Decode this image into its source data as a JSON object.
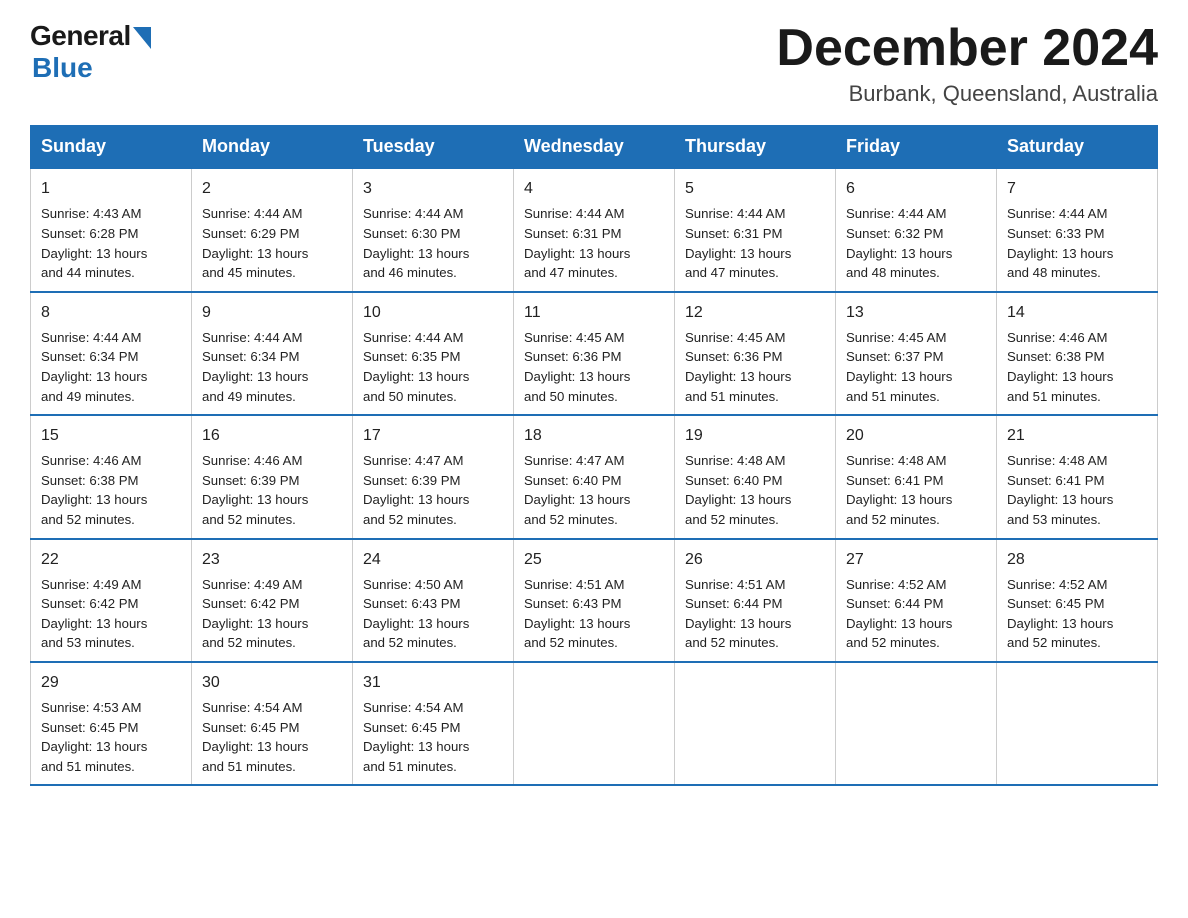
{
  "header": {
    "logo_general": "General",
    "logo_blue": "Blue",
    "month_title": "December 2024",
    "location": "Burbank, Queensland, Australia"
  },
  "days_of_week": [
    "Sunday",
    "Monday",
    "Tuesday",
    "Wednesday",
    "Thursday",
    "Friday",
    "Saturday"
  ],
  "weeks": [
    [
      {
        "day": "1",
        "sunrise": "4:43 AM",
        "sunset": "6:28 PM",
        "daylight": "13 hours and 44 minutes."
      },
      {
        "day": "2",
        "sunrise": "4:44 AM",
        "sunset": "6:29 PM",
        "daylight": "13 hours and 45 minutes."
      },
      {
        "day": "3",
        "sunrise": "4:44 AM",
        "sunset": "6:30 PM",
        "daylight": "13 hours and 46 minutes."
      },
      {
        "day": "4",
        "sunrise": "4:44 AM",
        "sunset": "6:31 PM",
        "daylight": "13 hours and 47 minutes."
      },
      {
        "day": "5",
        "sunrise": "4:44 AM",
        "sunset": "6:31 PM",
        "daylight": "13 hours and 47 minutes."
      },
      {
        "day": "6",
        "sunrise": "4:44 AM",
        "sunset": "6:32 PM",
        "daylight": "13 hours and 48 minutes."
      },
      {
        "day": "7",
        "sunrise": "4:44 AM",
        "sunset": "6:33 PM",
        "daylight": "13 hours and 48 minutes."
      }
    ],
    [
      {
        "day": "8",
        "sunrise": "4:44 AM",
        "sunset": "6:34 PM",
        "daylight": "13 hours and 49 minutes."
      },
      {
        "day": "9",
        "sunrise": "4:44 AM",
        "sunset": "6:34 PM",
        "daylight": "13 hours and 49 minutes."
      },
      {
        "day": "10",
        "sunrise": "4:44 AM",
        "sunset": "6:35 PM",
        "daylight": "13 hours and 50 minutes."
      },
      {
        "day": "11",
        "sunrise": "4:45 AM",
        "sunset": "6:36 PM",
        "daylight": "13 hours and 50 minutes."
      },
      {
        "day": "12",
        "sunrise": "4:45 AM",
        "sunset": "6:36 PM",
        "daylight": "13 hours and 51 minutes."
      },
      {
        "day": "13",
        "sunrise": "4:45 AM",
        "sunset": "6:37 PM",
        "daylight": "13 hours and 51 minutes."
      },
      {
        "day": "14",
        "sunrise": "4:46 AM",
        "sunset": "6:38 PM",
        "daylight": "13 hours and 51 minutes."
      }
    ],
    [
      {
        "day": "15",
        "sunrise": "4:46 AM",
        "sunset": "6:38 PM",
        "daylight": "13 hours and 52 minutes."
      },
      {
        "day": "16",
        "sunrise": "4:46 AM",
        "sunset": "6:39 PM",
        "daylight": "13 hours and 52 minutes."
      },
      {
        "day": "17",
        "sunrise": "4:47 AM",
        "sunset": "6:39 PM",
        "daylight": "13 hours and 52 minutes."
      },
      {
        "day": "18",
        "sunrise": "4:47 AM",
        "sunset": "6:40 PM",
        "daylight": "13 hours and 52 minutes."
      },
      {
        "day": "19",
        "sunrise": "4:48 AM",
        "sunset": "6:40 PM",
        "daylight": "13 hours and 52 minutes."
      },
      {
        "day": "20",
        "sunrise": "4:48 AM",
        "sunset": "6:41 PM",
        "daylight": "13 hours and 52 minutes."
      },
      {
        "day": "21",
        "sunrise": "4:48 AM",
        "sunset": "6:41 PM",
        "daylight": "13 hours and 53 minutes."
      }
    ],
    [
      {
        "day": "22",
        "sunrise": "4:49 AM",
        "sunset": "6:42 PM",
        "daylight": "13 hours and 53 minutes."
      },
      {
        "day": "23",
        "sunrise": "4:49 AM",
        "sunset": "6:42 PM",
        "daylight": "13 hours and 52 minutes."
      },
      {
        "day": "24",
        "sunrise": "4:50 AM",
        "sunset": "6:43 PM",
        "daylight": "13 hours and 52 minutes."
      },
      {
        "day": "25",
        "sunrise": "4:51 AM",
        "sunset": "6:43 PM",
        "daylight": "13 hours and 52 minutes."
      },
      {
        "day": "26",
        "sunrise": "4:51 AM",
        "sunset": "6:44 PM",
        "daylight": "13 hours and 52 minutes."
      },
      {
        "day": "27",
        "sunrise": "4:52 AM",
        "sunset": "6:44 PM",
        "daylight": "13 hours and 52 minutes."
      },
      {
        "day": "28",
        "sunrise": "4:52 AM",
        "sunset": "6:45 PM",
        "daylight": "13 hours and 52 minutes."
      }
    ],
    [
      {
        "day": "29",
        "sunrise": "4:53 AM",
        "sunset": "6:45 PM",
        "daylight": "13 hours and 51 minutes."
      },
      {
        "day": "30",
        "sunrise": "4:54 AM",
        "sunset": "6:45 PM",
        "daylight": "13 hours and 51 minutes."
      },
      {
        "day": "31",
        "sunrise": "4:54 AM",
        "sunset": "6:45 PM",
        "daylight": "13 hours and 51 minutes."
      },
      null,
      null,
      null,
      null
    ]
  ],
  "labels": {
    "sunrise": "Sunrise:",
    "sunset": "Sunset:",
    "daylight": "Daylight:"
  }
}
